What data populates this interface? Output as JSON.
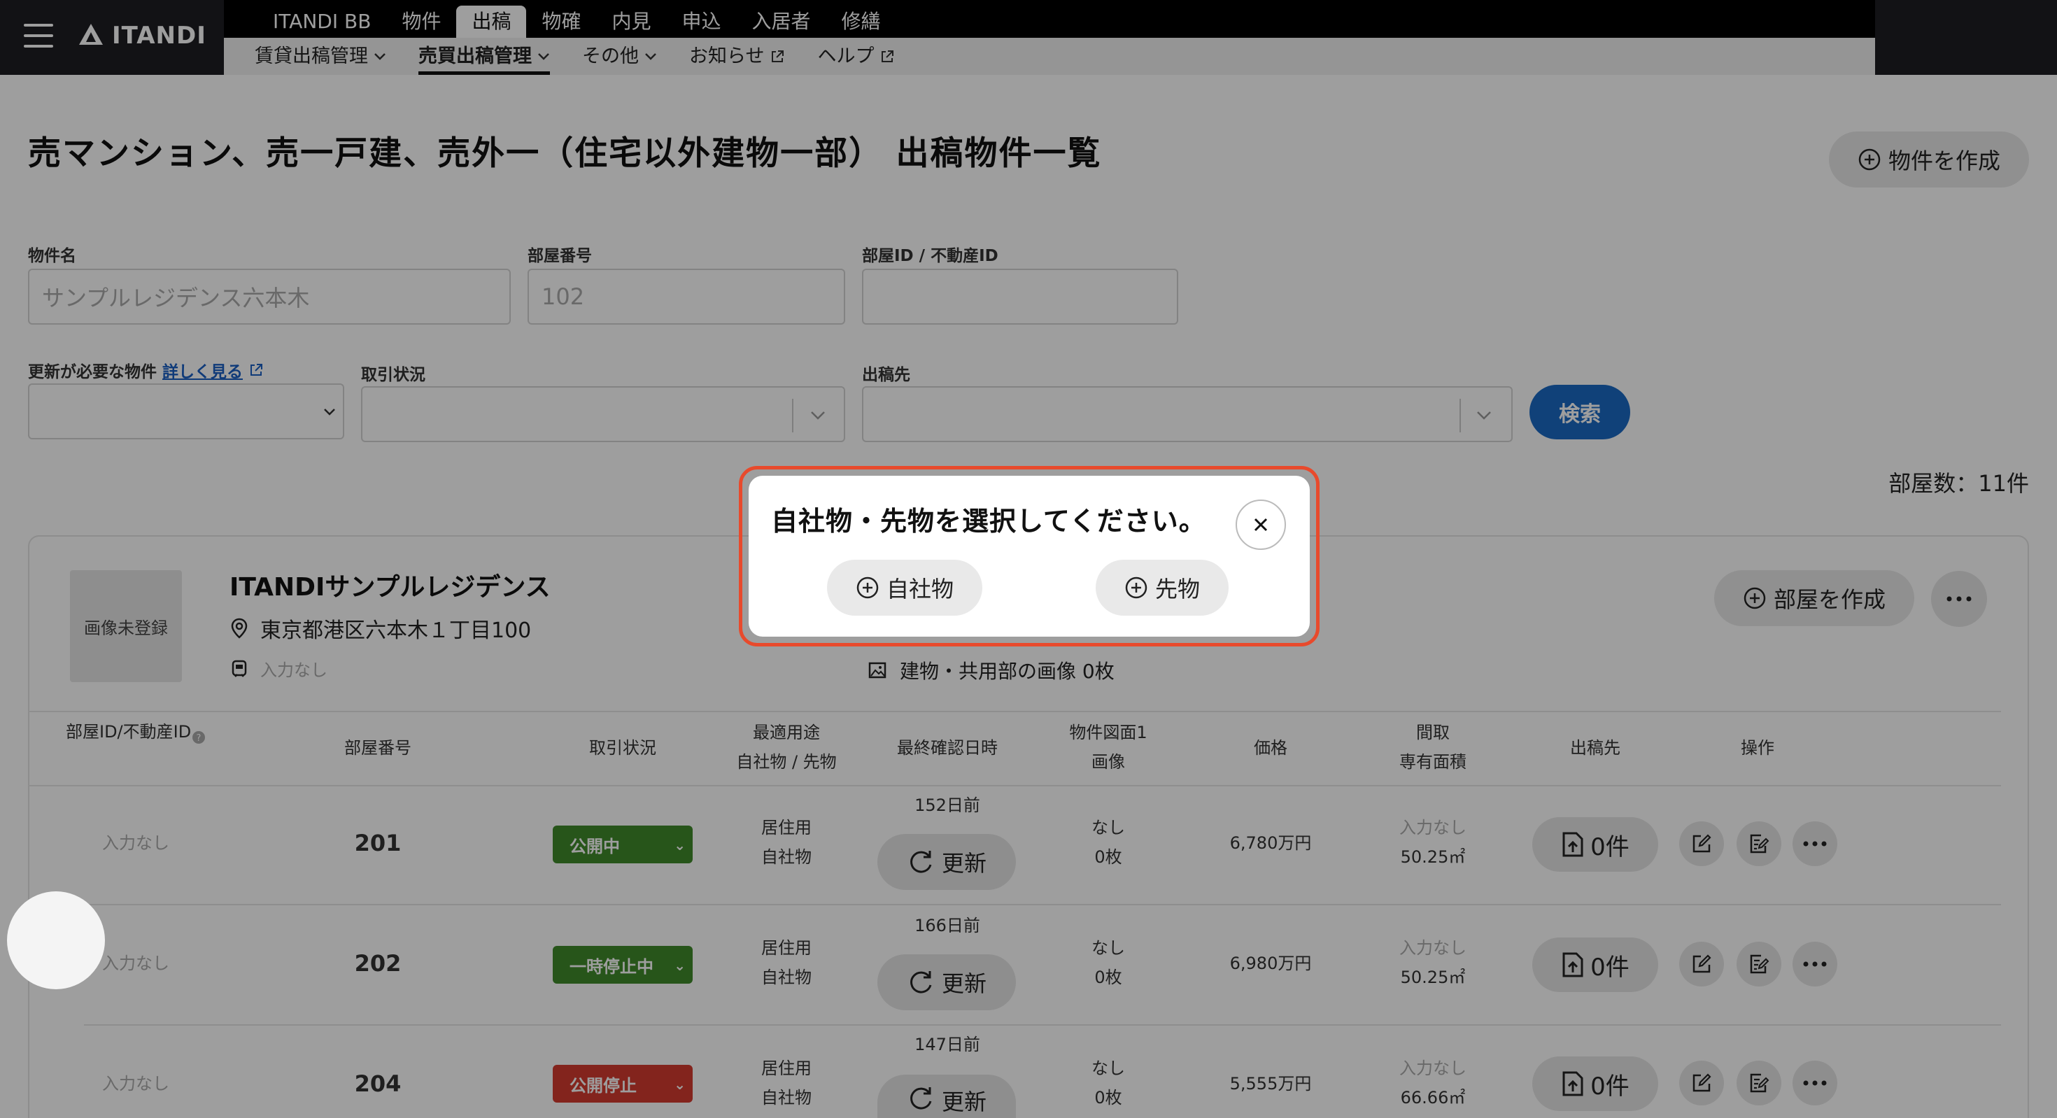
{
  "header": {
    "logo_text": "ITANDI",
    "top_nav": [
      "ITANDI BB",
      "物件",
      "出稿",
      "物確",
      "内見",
      "申込",
      "入居者",
      "修繕"
    ],
    "sub_nav": {
      "rental": "賃貸出稿管理",
      "sale": "売買出稿管理",
      "other": "その他",
      "news": "お知らせ",
      "help": "ヘルプ"
    }
  },
  "page": {
    "title": "売マンション、売一戸建、売外一（住宅以外建物一部） 出稿物件一覧",
    "create_property_button": "物件を作成",
    "room_count": "部屋数：11件"
  },
  "filters": {
    "property_name_label": "物件名",
    "property_name_placeholder": "サンプルレジデンス六本木",
    "room_number_label": "部屋番号",
    "room_number_placeholder": "102",
    "room_id_label": "部屋ID / 不動産ID",
    "update_needed_label": "更新が必要な物件",
    "details_link": "詳しく見る",
    "deal_status_label": "取引状況",
    "destination_label": "出稿先",
    "search_button": "検索"
  },
  "property": {
    "no_image": "画像未登録",
    "name": "ITANDIサンプルレジデンス",
    "address": "東京都港区六本木１丁目100",
    "station": "入力なし",
    "building_images": "建物・共用部の画像 0枚",
    "create_room_button": "部屋を作成"
  },
  "table": {
    "headers": {
      "room_id": "部屋ID/不動産ID",
      "room_number": "部屋番号",
      "deal_status": "取引状況",
      "usage_1": "最適用途",
      "usage_2": "自社物 / 先物",
      "last_confirmed": "最終確認日時",
      "floorplan_1": "物件図面1",
      "floorplan_2": "画像",
      "price": "価格",
      "layout_1": "間取",
      "layout_2": "専有面積",
      "destination": "出稿先",
      "actions": "操作"
    },
    "rows": [
      {
        "room_id": "入力なし",
        "room_number": "201",
        "status": "公開中",
        "status_color": "#3f8a2a",
        "usage": "居住用",
        "ownership": "自社物",
        "days_ago": "152日前",
        "update": "更新",
        "floorplan": "なし",
        "images": "0枚",
        "price": "6,780万円",
        "layout": "入力なし",
        "area": "50.25㎡",
        "destinations": "0件"
      },
      {
        "room_id": "入力なし",
        "room_number": "202",
        "status": "一時停止中",
        "status_color": "#3f8a2a",
        "usage": "居住用",
        "ownership": "自社物",
        "days_ago": "166日前",
        "update": "更新",
        "floorplan": "なし",
        "images": "0枚",
        "price": "6,980万円",
        "layout": "入力なし",
        "area": "50.25㎡",
        "destinations": "0件"
      },
      {
        "room_id": "入力なし",
        "room_number": "204",
        "status": "公開停止",
        "status_color": "#d43b2f",
        "usage": "居住用",
        "ownership": "自社物",
        "days_ago": "147日前",
        "update": "更新",
        "floorplan": "なし",
        "images": "0枚",
        "price": "5,555万円",
        "layout": "入力なし",
        "area": "66.66㎡",
        "destinations": "0件"
      }
    ]
  },
  "modal": {
    "title": "自社物・先物を選択してください。",
    "own_button": "自社物",
    "other_button": "先物"
  }
}
